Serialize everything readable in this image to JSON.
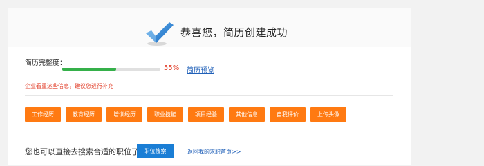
{
  "header": {
    "title": "恭喜您，简历创建成功"
  },
  "completeness": {
    "label": "简历完整度：",
    "percent_text": "55%",
    "progress_fraction": 0.55,
    "preview_link": "简历预览"
  },
  "notice": "企业看重这些信息，建议您进行补充",
  "sections": [
    {
      "label": "工作经历"
    },
    {
      "label": "教育经历"
    },
    {
      "label": "培训经历"
    },
    {
      "label": "职业技能"
    },
    {
      "label": "项目经验"
    },
    {
      "label": "其他信息"
    },
    {
      "label": "自我评价"
    },
    {
      "label": "上传头像"
    }
  ],
  "search": {
    "prompt": "您也可以直接去搜索合适的职位了",
    "button": "职位搜索",
    "back_link": "返回我的求职首页>>"
  },
  "colors": {
    "accent_orange": "#ff7a12",
    "accent_blue": "#1a7ed5",
    "progress_green": "#35b04a",
    "alert_red": "#e23d28"
  }
}
